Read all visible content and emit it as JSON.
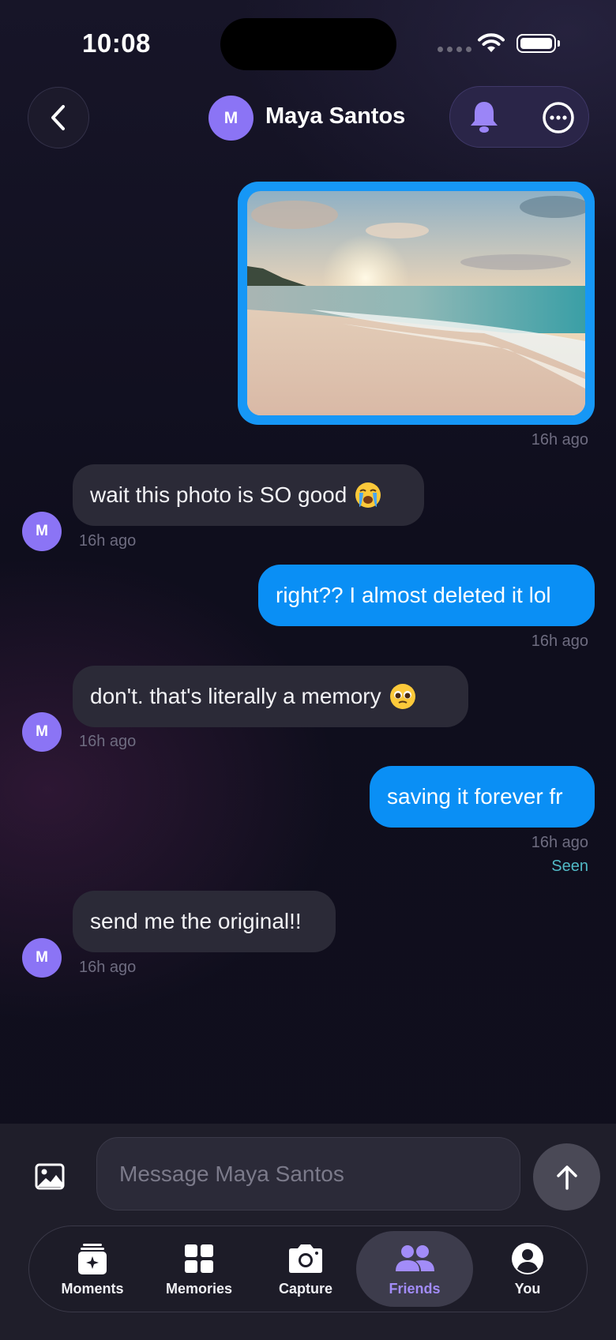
{
  "status_bar": {
    "time": "10:08"
  },
  "header": {
    "contact_name": "Maya Santos",
    "avatar_initial": "M"
  },
  "messages": [
    {
      "type": "photo",
      "direction": "sent",
      "time": "16h ago"
    },
    {
      "type": "text",
      "direction": "received",
      "text": "wait this photo is SO good",
      "emoji": "loudly-crying-face",
      "time": "16h ago",
      "avatar": "M"
    },
    {
      "type": "text",
      "direction": "sent",
      "text": "right?? I almost deleted it lol",
      "time": "16h ago"
    },
    {
      "type": "text",
      "direction": "received",
      "text": "don't. that's literally a memory",
      "emoji": "pleading-face",
      "time": "16h ago",
      "avatar": "M"
    },
    {
      "type": "text",
      "direction": "sent",
      "text": "saving it forever fr",
      "time": "16h ago",
      "status": "Seen"
    },
    {
      "type": "text",
      "direction": "received",
      "text": "send me the original!!",
      "time": "16h ago",
      "avatar": "M"
    }
  ],
  "composer": {
    "placeholder": "Message Maya Santos"
  },
  "tabs": [
    {
      "label": "Moments",
      "icon": "moments-icon",
      "active": false
    },
    {
      "label": "Memories",
      "icon": "grid-icon",
      "active": false
    },
    {
      "label": "Capture",
      "icon": "camera-icon",
      "active": false
    },
    {
      "label": "Friends",
      "icon": "friends-icon",
      "active": true
    },
    {
      "label": "You",
      "icon": "profile-icon",
      "active": false
    }
  ],
  "colors": {
    "accent": "#8b74f5",
    "sent_bubble": "#0a8ff5",
    "received_bubble": "#2b2a37",
    "seen": "#51b9c6"
  }
}
